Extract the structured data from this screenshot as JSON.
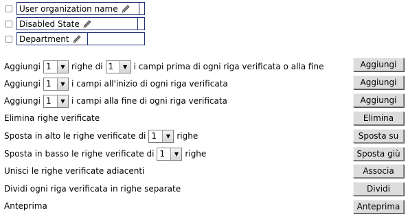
{
  "fields": [
    {
      "label": "User organization name"
    },
    {
      "label": "Disabled State"
    },
    {
      "label": "Department"
    }
  ],
  "actions": [
    {
      "parts": [
        "Aggiungi",
        "righe di",
        "i campi prima di ogni riga verificata o alla fine"
      ],
      "selects": [
        "1",
        "1"
      ],
      "button": "Aggiungi"
    },
    {
      "parts": [
        "Aggiungi",
        "i campi all'inizio di ogni riga verificata"
      ],
      "selects": [
        "1"
      ],
      "button": "Aggiungi"
    },
    {
      "parts": [
        "Aggiungi",
        "i campi alla fine di ogni riga verificata"
      ],
      "selects": [
        "1"
      ],
      "button": "Aggiungi"
    },
    {
      "parts": [
        "Elimina righe verificate"
      ],
      "button": "Elimina"
    },
    {
      "parts": [
        "Sposta in alto le righe verificate di",
        "righe"
      ],
      "selects": [
        "1"
      ],
      "button": "Sposta su"
    },
    {
      "parts": [
        "Sposta in basso le righe verificate di",
        "righe"
      ],
      "selects": [
        "1"
      ],
      "button": "Sposta giù"
    },
    {
      "parts": [
        "Unisci le righe verificate adiacenti"
      ],
      "button": "Associa"
    },
    {
      "parts": [
        "Dividi ogni riga verificata in righe separate"
      ],
      "button": "Dividi"
    },
    {
      "parts": [
        "Anteprima"
      ],
      "button": "Anteprima"
    }
  ],
  "icons": {
    "field_edit": "pencil-icon",
    "dropdown": "triangle-down-icon"
  }
}
